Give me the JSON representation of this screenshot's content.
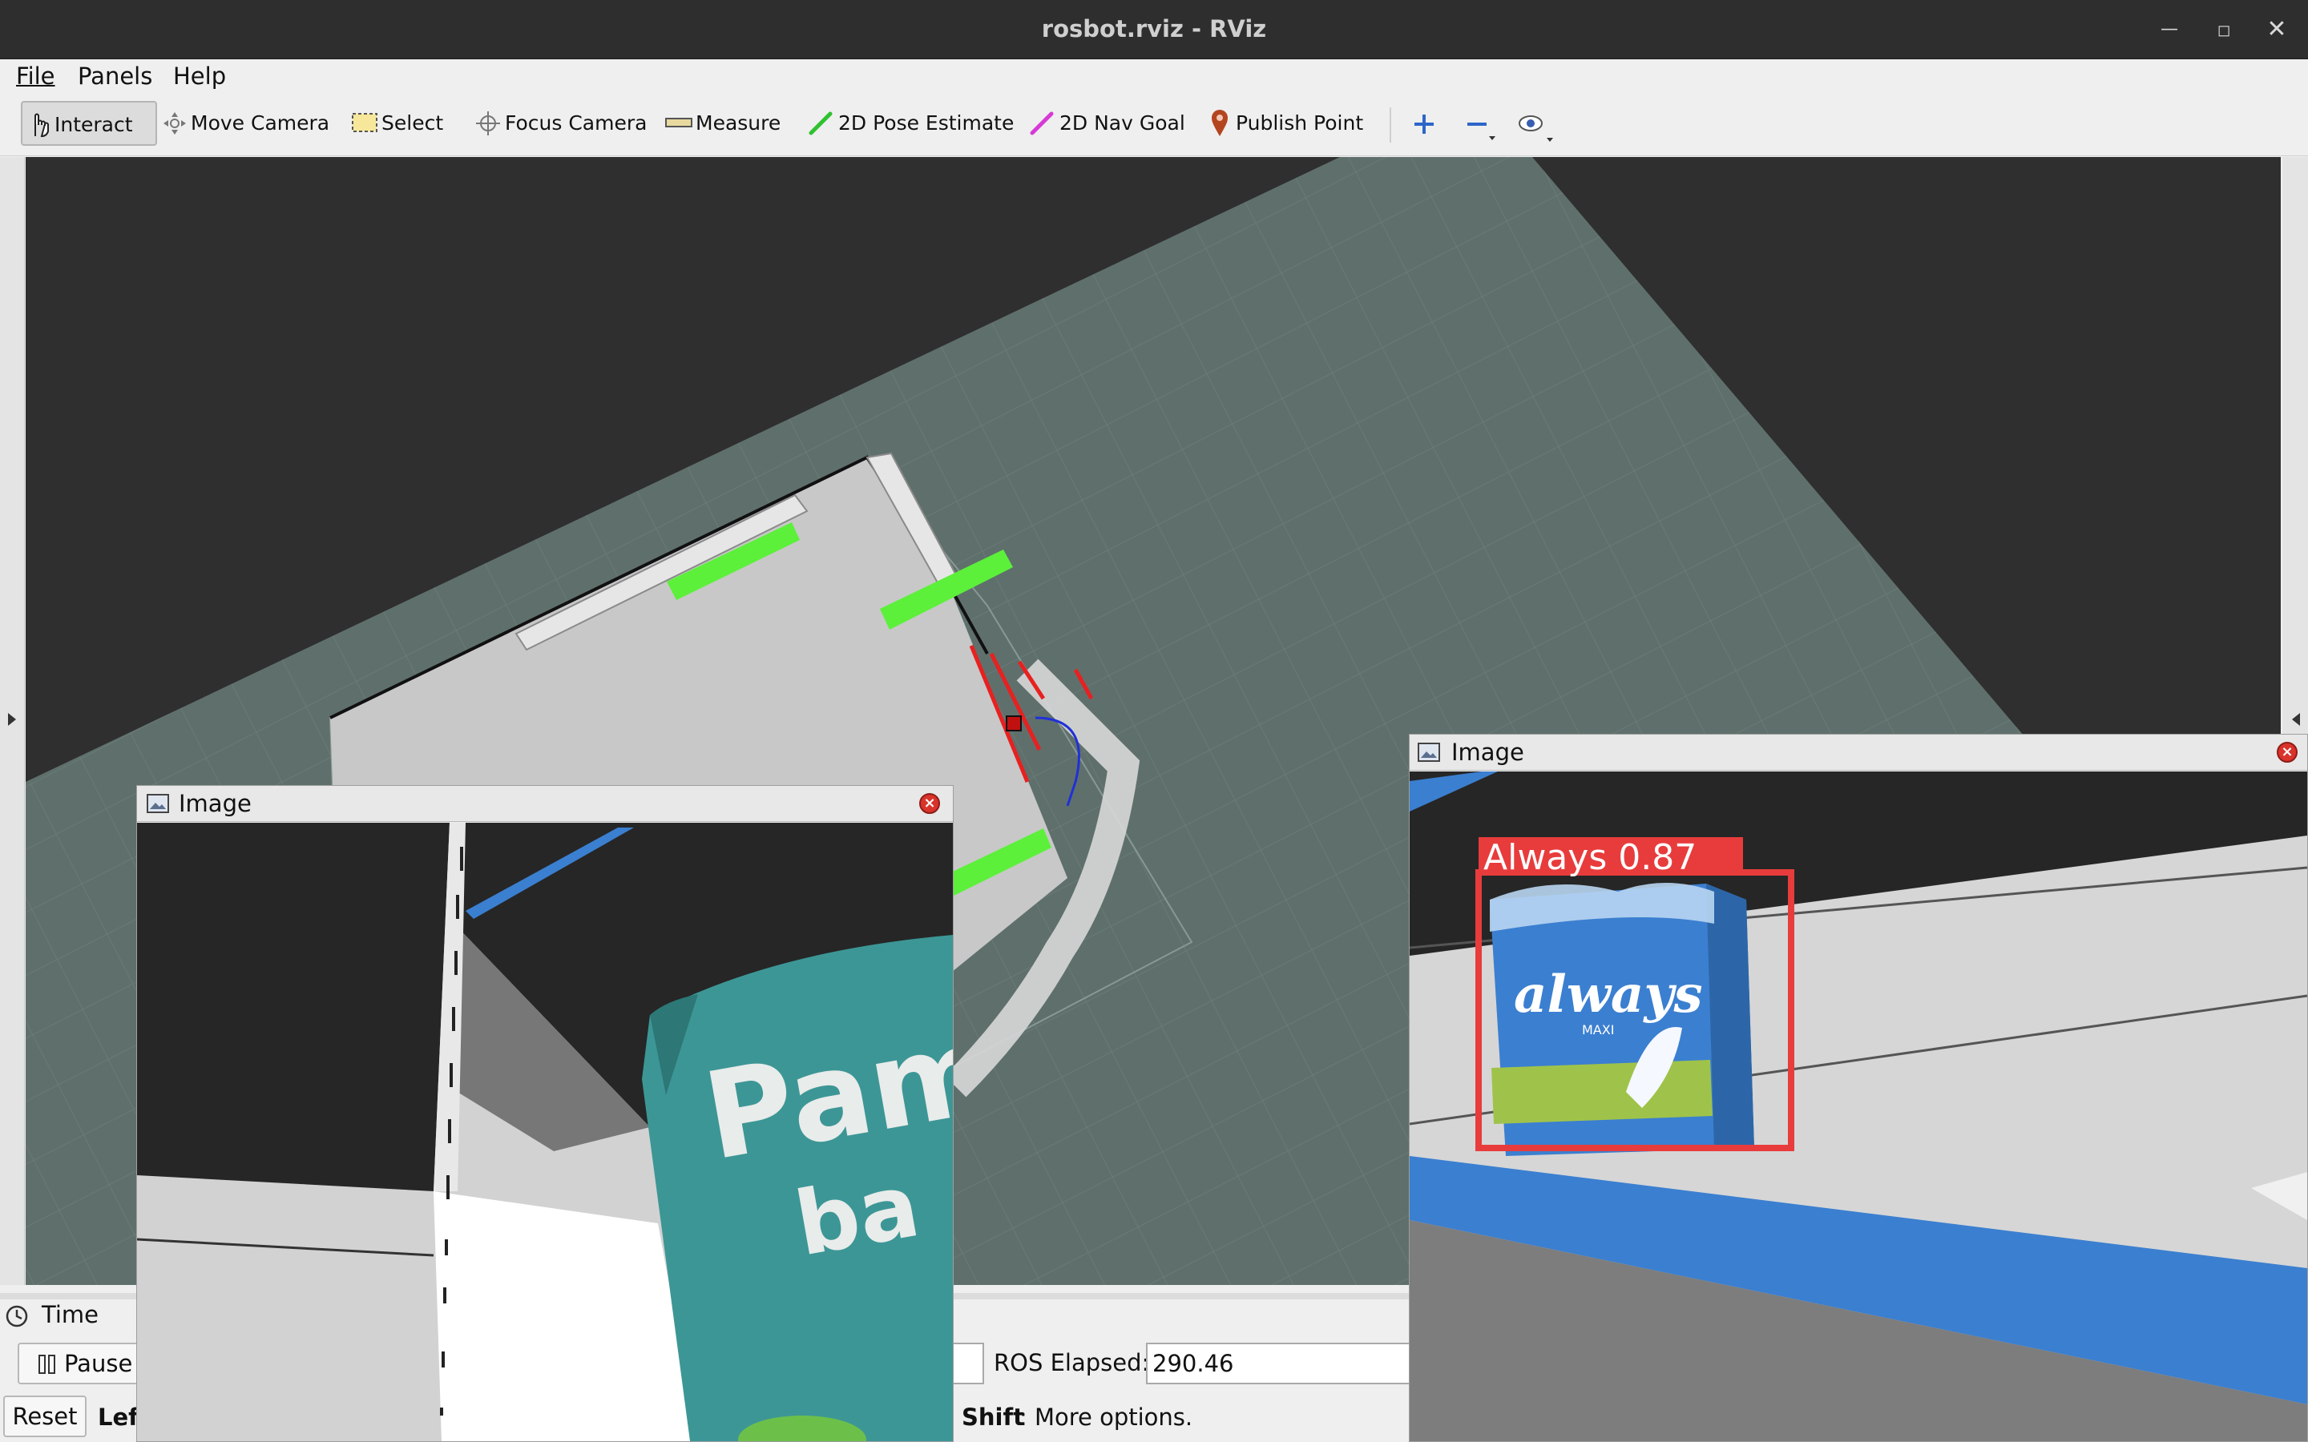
{
  "window": {
    "title": "rosbot.rviz - RViz"
  },
  "menu": [
    {
      "label": "File"
    },
    {
      "label": "Panels"
    },
    {
      "label": "Help"
    }
  ],
  "toolbar": {
    "interact": "Interact",
    "move_camera": "Move Camera",
    "select": "Select",
    "focus_camera": "Focus Camera",
    "measure": "Measure",
    "pose_estimate": "2D Pose Estimate",
    "nav_goal": "2D Nav Goal",
    "publish_point": "Publish Point"
  },
  "time_panel": {
    "title": "Time",
    "pause_label": "Pause",
    "ros_elapsed_label": "ROS Elapsed:",
    "ros_elapsed_value": "290.46",
    "reset_label": "Reset",
    "status_left": "Lef",
    "status_right_key": "Shift",
    "status_right_text": ": More options."
  },
  "image_panel_left": {
    "title": "Image",
    "product_text_1": "Pam",
    "product_text_2": "ba"
  },
  "image_panel_right": {
    "title": "Image",
    "detection_label": "Always 0.87",
    "detection_class": "Always",
    "detection_confidence": 0.87,
    "product_brand": "always",
    "product_sub": "MAXI"
  },
  "colors": {
    "grid_floor": "#5f706c",
    "obstacle": "#5cf03a",
    "detection_box": "#e83c3c",
    "pampers_teal": "#3d9696",
    "always_blue": "#3b7fd0"
  }
}
